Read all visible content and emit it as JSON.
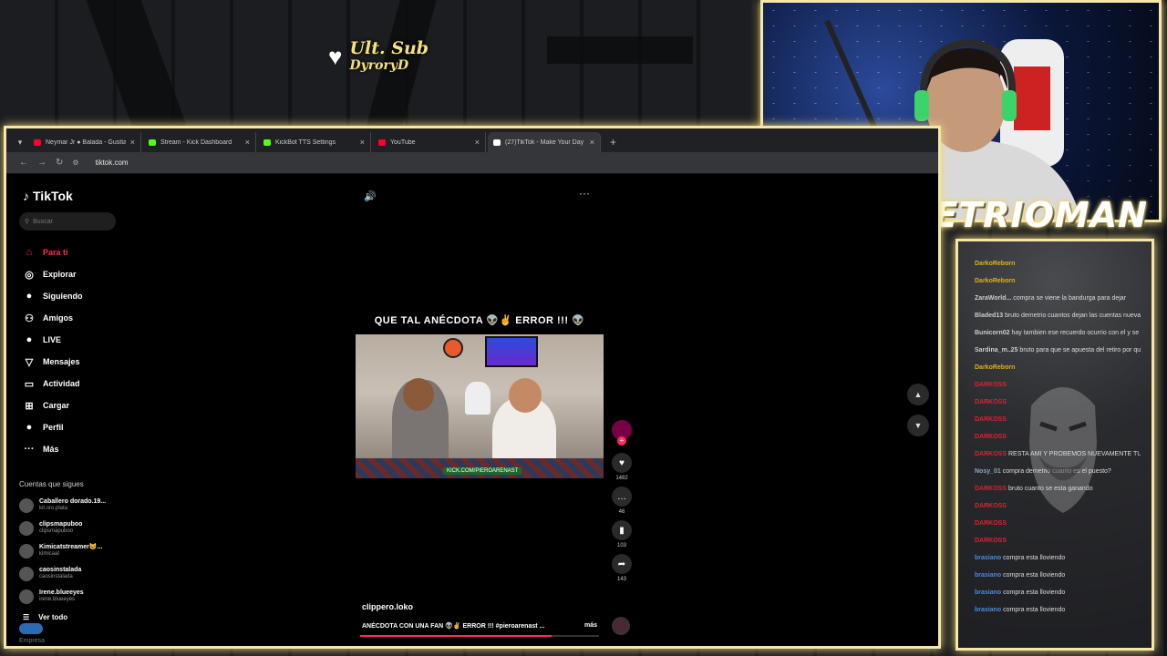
{
  "overlay": {
    "last_sub_label": "Ult. Sub",
    "last_sub_name": "DyroryD",
    "streamer_name": "DEMETRIOMAN"
  },
  "browser": {
    "tabs": [
      {
        "label": "Neymar Jr ● Balada - Gusttavo",
        "icon": "youtube-icon",
        "color": "#ff0033"
      },
      {
        "label": "Stream - Kick Dashboard",
        "icon": "kick-icon",
        "color": "#53fc18"
      },
      {
        "label": "KickBot TTS Settings",
        "icon": "kick-icon",
        "color": "#53fc18"
      },
      {
        "label": "YouTube",
        "icon": "youtube-icon",
        "color": "#ff0033"
      },
      {
        "label": "(27)TikTok - Make Your Day",
        "icon": "tiktok-icon",
        "color": "#ffffff"
      }
    ],
    "url": "tiktok.com"
  },
  "tiktok": {
    "logo": "TikTok",
    "search_placeholder": "Buscar",
    "nav": [
      {
        "label": "Para ti",
        "icon": "home-icon",
        "glyph": "⌂",
        "active": true
      },
      {
        "label": "Explorar",
        "icon": "compass-icon",
        "glyph": "◎"
      },
      {
        "label": "Siguiendo",
        "icon": "following-icon",
        "glyph": "●"
      },
      {
        "label": "Amigos",
        "icon": "friends-icon",
        "glyph": "⚇"
      },
      {
        "label": "LIVE",
        "icon": "live-icon",
        "glyph": "●"
      },
      {
        "label": "Mensajes",
        "icon": "messages-icon",
        "glyph": "▽"
      },
      {
        "label": "Actividad",
        "icon": "activity-icon",
        "glyph": "▭"
      },
      {
        "label": "Cargar",
        "icon": "upload-icon",
        "glyph": "⊞"
      },
      {
        "label": "Perfil",
        "icon": "profile-icon",
        "glyph": "●"
      },
      {
        "label": "Más",
        "icon": "more-icon",
        "glyph": "···"
      }
    ],
    "following_title": "Cuentas que sigues",
    "accounts": [
      {
        "name": "Caballero dorado.19...",
        "handle": "kit.oro.plata"
      },
      {
        "name": "clipsmapuboo",
        "handle": "clipsmapuboo"
      },
      {
        "name": "Kimicatstreamer😺...",
        "handle": "kimicaat"
      },
      {
        "name": "caosinstalada",
        "handle": "caosinstalada"
      },
      {
        "name": "Irene.blueeyes",
        "handle": "irene.blueeyes"
      }
    ],
    "see_all": "Ver todo",
    "footer": "Empresa",
    "video": {
      "caption": "QUE TAL ANÉCDOTA 👽✌️ ERROR !!! 👽",
      "watermark": "KICK.COM/PIEROARENAST",
      "likes": "1482",
      "comments": "46",
      "saves": "103",
      "shares": "143",
      "username": "clippero.loko",
      "description": "ANÉCDOTA CON UNA FAN 👽✌️ ERROR !!! #pieroarenast ...",
      "more_label": "más",
      "progress": 0.8
    }
  },
  "chat": {
    "messages": [
      {
        "user": "DarkoReborn",
        "text": "",
        "color": "#e0b020"
      },
      {
        "user": "DarkoReborn",
        "text": "",
        "color": "#e0b020"
      },
      {
        "user": "ZaraWorld...",
        "text": "compra se viene la bandurga para dejar",
        "color": "#cfcfcf"
      },
      {
        "user": "Bladed13",
        "text": "bruto demetrio cuantos dejan las cuentas nuevas y podrias poner como en la mia",
        "color": "#ccc"
      },
      {
        "user": "Bunicorn02",
        "text": "hay tambien ese recuerdo ocurrio con el y se metio las dos tomas ahora",
        "color": "#ccc"
      },
      {
        "user": "Sardina_m..25",
        "text": "bruto para que se apuesta del retiro por que usted ya sabe este dandote asi",
        "color": "#ccc"
      },
      {
        "user": "DarkoReborn",
        "text": "",
        "color": "#e0b020"
      },
      {
        "user": "DARKOSS",
        "text": "",
        "color": "#d23"
      },
      {
        "user": "DARKOSS",
        "text": "",
        "color": "#d23"
      },
      {
        "user": "DARKOSS",
        "text": "",
        "color": "#d23"
      },
      {
        "user": "DARKOSS",
        "text": "",
        "color": "#d23"
      },
      {
        "user": "DARKOSS",
        "text": "RESTA AMI Y PROBEMOS NUEVAMENTE TU PROPINA SE EJECUTA SOLO EN CON TU CARGOMERCIA",
        "color": "#d23"
      },
      {
        "user": "Nosy_01",
        "text": "compra demetrio cuanto es el puesto?",
        "color": "#8ab"
      },
      {
        "user": "DARKOSS",
        "text": "bruto cuanto se esta ganando",
        "color": "#d23"
      },
      {
        "user": "DARKOSS",
        "text": "",
        "color": "#d23"
      },
      {
        "user": "DARKOSS",
        "text": "",
        "color": "#d23"
      },
      {
        "user": "DARKOSS",
        "text": "",
        "color": "#d23"
      },
      {
        "user": "brasiano",
        "text": "compra esta lloviendo",
        "color": "#4a8ae0"
      },
      {
        "user": "brasiano",
        "text": "compra esta lloviendo",
        "color": "#4a8ae0"
      },
      {
        "user": "brasiano",
        "text": "compra esta lloviendo",
        "color": "#4a8ae0"
      },
      {
        "user": "brasiano",
        "text": "compra esta lloviendo",
        "color": "#4a8ae0"
      }
    ]
  }
}
